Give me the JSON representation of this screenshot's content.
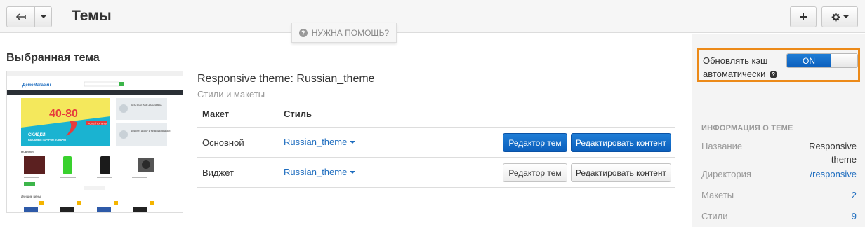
{
  "header": {
    "title": "Темы",
    "help_label": "НУЖНА ПОМОЩЬ?"
  },
  "main": {
    "section_title": "Выбранная тема",
    "theme_name": "Responsive theme: Russian_theme",
    "theme_subtitle": "Стили и макеты",
    "table": {
      "headers": [
        "Макет",
        "Стиль"
      ],
      "rows": [
        {
          "layout": "Основной",
          "style": "Russian_theme",
          "editor_label": "Редактор тем",
          "content_label": "Редактировать контент",
          "primary": true
        },
        {
          "layout": "Виджет",
          "style": "Russian_theme",
          "editor_label": "Редактор тем",
          "content_label": "Редактировать контент",
          "primary": false
        }
      ]
    },
    "preview": {
      "logo": "ДемоМагазин",
      "banner_numbers": "40-80",
      "banner_button": "УСПЕЙ КУПИТЬ",
      "banner_text1": "СКИДКИ",
      "banner_text2": "НА САМЫЕ ГОРЯЧИЕ ТОВАРЫ",
      "promo1": "БЕСПЛАТНАЯ ДОСТАВКА",
      "promo2": "ВОЗВРАТ ДЕНЕГ В ТЕЧЕНИЕ 30 ДНЕЙ",
      "section1": "Новинки",
      "section2": "Лучшие цены"
    }
  },
  "sidebar": {
    "cache_label": "Обновлять кэш автоматически",
    "toggle_label": "ON",
    "toggle_on": true,
    "info_title": "ИНФОРМАЦИЯ О ТЕМЕ",
    "info": [
      {
        "label": "Название",
        "value": "Responsive theme"
      },
      {
        "label": "Директория",
        "value": "/responsive"
      },
      {
        "label": "Макеты",
        "value": "2"
      },
      {
        "label": "Стили",
        "value": "9"
      }
    ]
  },
  "colors": {
    "accent": "#0b5fbd",
    "link": "#1e6dbf",
    "highlight_border": "#ec8a18",
    "banner_yellow": "#f4e85c",
    "banner_cyan": "#1ab3d1",
    "banner_red": "#e63c3c"
  },
  "icons": [
    "back-arrow-icon",
    "chevron-down-icon",
    "plus-icon",
    "gear-icon",
    "question-icon"
  ]
}
